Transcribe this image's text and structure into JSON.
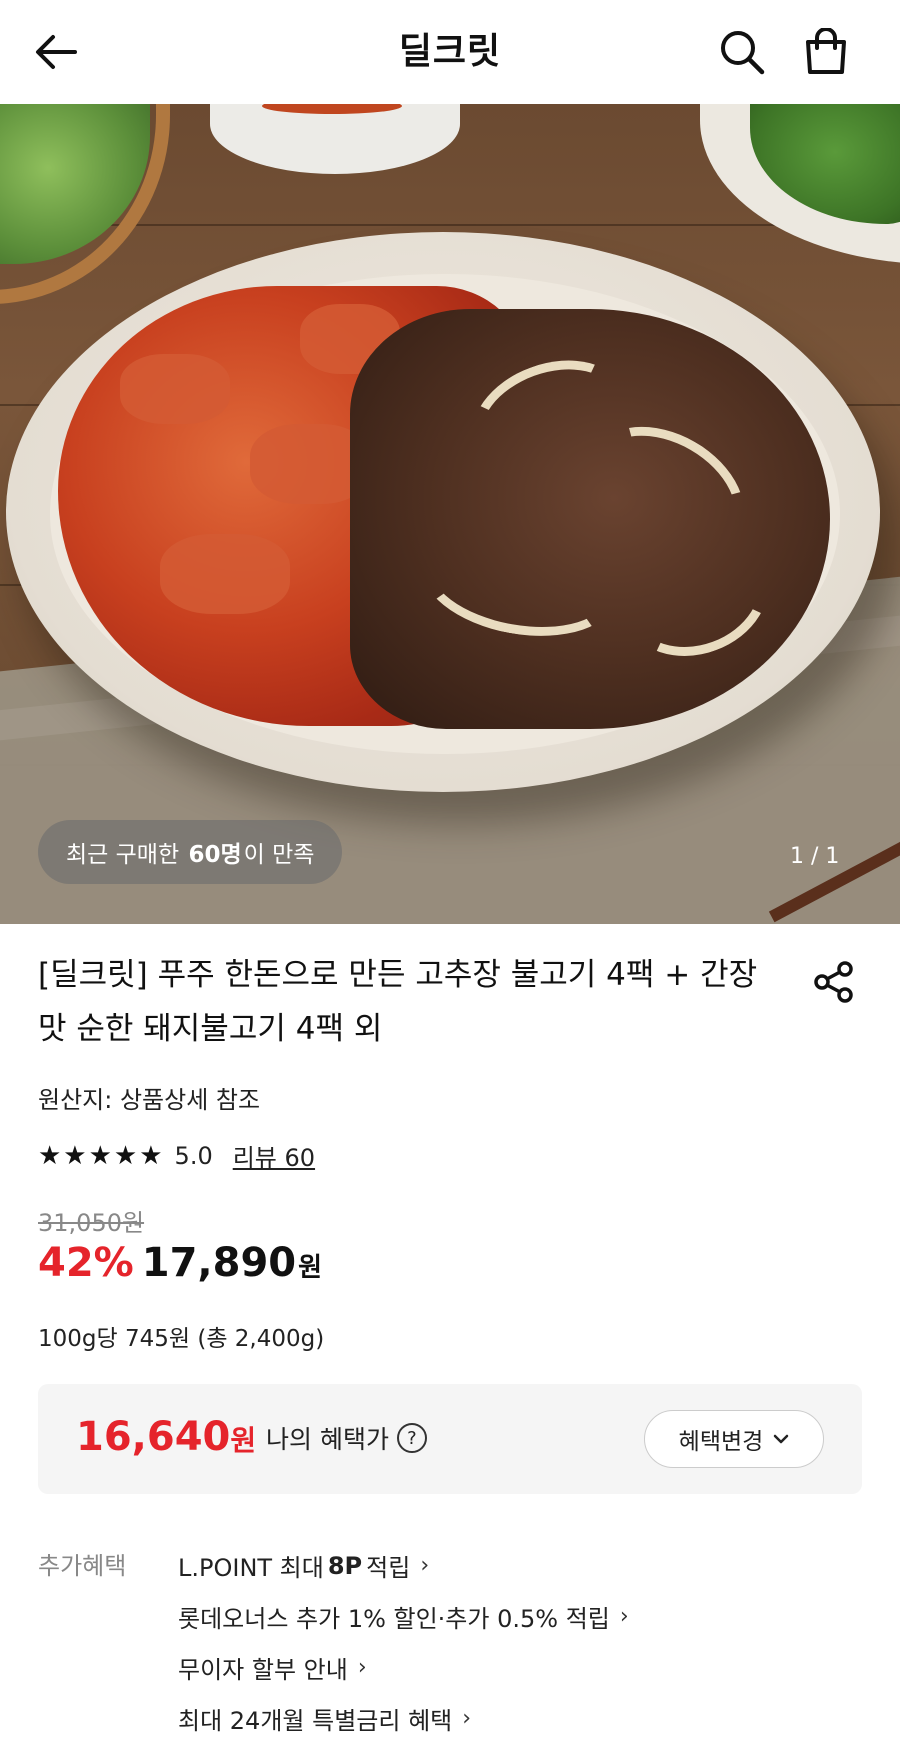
{
  "header": {
    "title": "딜크릿",
    "back_icon": "arrow-left-icon",
    "search_icon": "search-icon",
    "cart_icon": "shopping-bag-icon"
  },
  "hero": {
    "badge_prefix": "최근 구매한",
    "badge_count": "60명",
    "badge_suffix": "이 만족",
    "counter": "1 / 1"
  },
  "product": {
    "title": "[딜크릿] 푸주 한돈으로 만든 고추장 불고기 4팩 + 간장맛 순한 돼지불고기 4팩 외",
    "origin": "원산지: 상품상세 참조",
    "stars": "★★★★★",
    "rating": "5.0",
    "review_link": "리뷰 60",
    "original_price": "31,050원",
    "discount": "42%",
    "price": "17,890",
    "currency": "원",
    "unit_price": "100g당 745원 (총 2,400g)"
  },
  "benefit": {
    "price": "16,640",
    "currency": "원",
    "label": "나의 혜택가",
    "help": "?",
    "change_button": "혜택변경"
  },
  "extra_benefits": {
    "label": "추가혜택",
    "items": [
      {
        "pre": "L.POINT 최대",
        "bold": "8P",
        "post": "적립"
      },
      {
        "text": "롯데오너스 추가 1% 할인·추가 0.5% 적립"
      },
      {
        "text": "무이자 할부 안내"
      },
      {
        "text": "최대 24개월 특별금리 혜택"
      }
    ]
  },
  "colors": {
    "accent_red": "#e5242b"
  }
}
